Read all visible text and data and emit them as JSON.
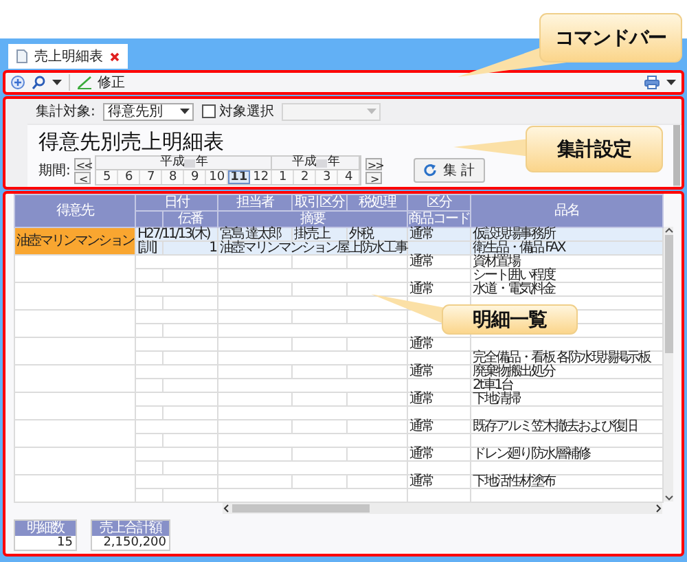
{
  "tab": {
    "label": "売上明細表",
    "selected": true
  },
  "command_bar": {
    "edit_label": "修正"
  },
  "summary": {
    "target_label": "集計対象:",
    "target_value": "得意先別",
    "target_select": {
      "label": "対象選択",
      "checked": false
    },
    "filter": {
      "disabled": true
    },
    "title": "得意先別売上明細表",
    "period_label": "期間:",
    "nav": {
      "first": "<<",
      "prev": "<",
      "last": ">>",
      "next": ">"
    },
    "years": [
      {
        "era": "平成",
        "suffix": "年",
        "months": [
          {
            "label": "5",
            "selected": false
          },
          {
            "label": "6",
            "selected": false
          },
          {
            "label": "7",
            "selected": false
          },
          {
            "label": "8",
            "selected": false
          },
          {
            "label": "9",
            "selected": false
          },
          {
            "label": "10",
            "selected": false
          },
          {
            "label": "11",
            "selected": true
          },
          {
            "label": "12",
            "selected": false
          }
        ]
      },
      {
        "era": "平成",
        "suffix": "年",
        "months": [
          {
            "label": "1",
            "selected": false
          },
          {
            "label": "2",
            "selected": false
          },
          {
            "label": "3",
            "selected": false
          },
          {
            "label": "4",
            "selected": false
          }
        ]
      }
    ],
    "run_button": "集 計"
  },
  "table": {
    "header_row_1": [
      "得意先",
      "日付",
      "担当者",
      "取引区分",
      "税処理",
      "区分",
      "品名"
    ],
    "header_row_2": [
      "伝番",
      "摘要",
      "商品コード"
    ],
    "rows": [
      {
        "customer": "油壺マリンマンション",
        "date": "H27/11/13(木)",
        "staff": "宮島 達太郎",
        "deal_type": "掛売上",
        "tax": "外税",
        "category": "通常",
        "item_name": "仮設現場事務所",
        "mark": "[訓]",
        "slip_no": "1",
        "memo": "油壺マリンマンション屋上防水工事",
        "item_detail": "衛生品・備品 FAX",
        "selected": true
      },
      {
        "category": "通常",
        "item_name": "資材置場",
        "item_detail": "シート囲い程度",
        "selected": false
      },
      {
        "category": "通常",
        "item_name": "水道・電気料金",
        "selected": false
      },
      {
        "selected": false
      },
      {
        "category": "通常",
        "item_detail": "完全備品・看板 各防水現場掲示板",
        "selected": false
      },
      {
        "category": "通常",
        "item_name": "廃棄物搬出処分",
        "item_detail": "2t車1台",
        "selected": false
      },
      {
        "category": "通常",
        "item_name": "下地清掃",
        "selected": false
      },
      {
        "category": "通常",
        "item_name": "既存アルミ笠木撤去および復旧",
        "selected": false
      },
      {
        "category": "通常",
        "item_name": "ドレン廻り防水層補修",
        "selected": false
      },
      {
        "category": "通常",
        "item_name": "下地活性材塗布",
        "selected": false
      }
    ]
  },
  "totals": [
    {
      "label": "明細数",
      "value": "15"
    },
    {
      "label": "売上合計額",
      "value": "2,150,200"
    }
  ],
  "callouts": [
    {
      "text": "コマンドバー"
    },
    {
      "text": "集計設定"
    },
    {
      "text": "明細一覧"
    }
  ]
}
